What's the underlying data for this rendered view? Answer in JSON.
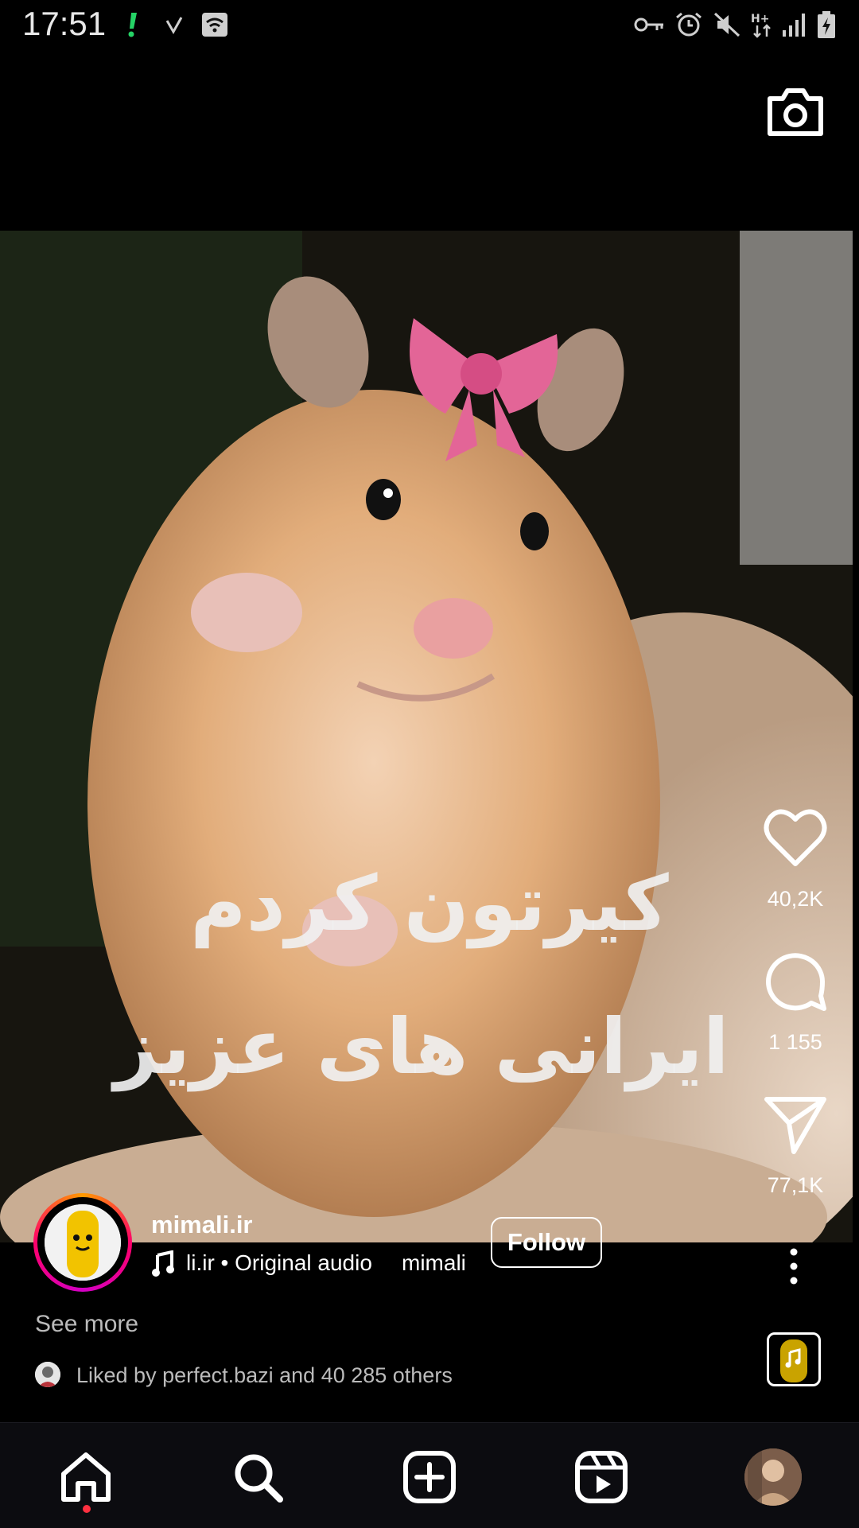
{
  "status_bar": {
    "time": "17:51"
  },
  "reel": {
    "caption_overlay": {
      "line1": "کیرتون کردم",
      "line2": "ایرانی های عزیز"
    },
    "likes_count": "40,2K",
    "comments_count": "1 155",
    "shares_count": "77,1K",
    "author": {
      "username": "mimali.ir",
      "follow_label": "Follow",
      "audio_text": "li.ir • Original audio",
      "audio_tag": "mimali"
    },
    "see_more": "See more",
    "liked_by": "Liked by perfect.bazi and 40 285 others"
  },
  "colors": {
    "accent_red": "#ff3040",
    "background": "#000000"
  },
  "nav": {
    "items": [
      "home-icon",
      "search-icon",
      "create-icon",
      "reels-icon",
      "profile-avatar"
    ]
  }
}
